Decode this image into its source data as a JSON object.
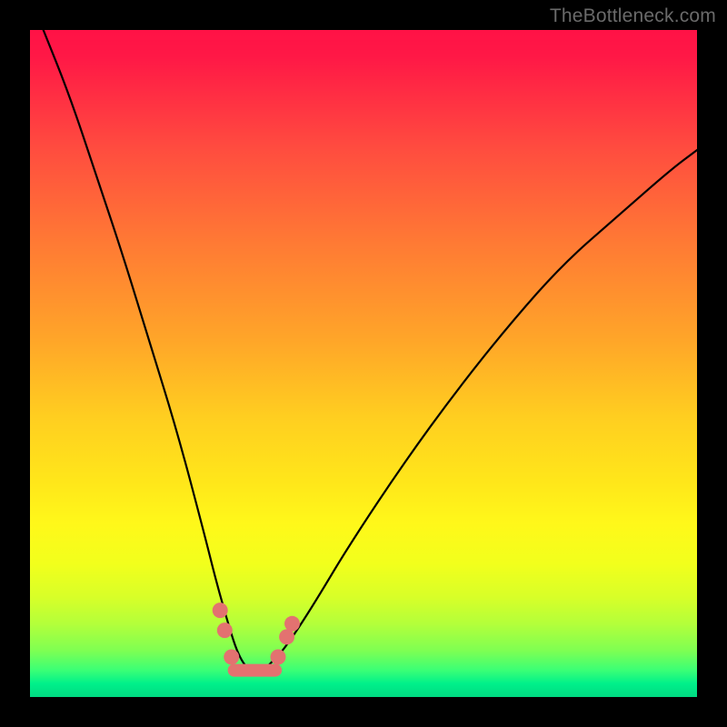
{
  "watermark": "TheBottleneck.com",
  "chart_data": {
    "type": "line",
    "title": "",
    "xlabel": "",
    "ylabel": "",
    "xlim": [
      0,
      100
    ],
    "ylim": [
      0,
      100
    ],
    "gradient_meaning": "background color encodes bottleneck severity: red=high (bad), green=low (optimal)",
    "series": [
      {
        "name": "bottleneck-curve",
        "x": [
          2,
          6,
          10,
          14,
          18,
          22,
          26,
          28,
          30,
          31,
          32,
          33,
          34,
          35,
          36,
          38,
          42,
          48,
          56,
          64,
          72,
          80,
          88,
          96,
          100
        ],
        "values": [
          100,
          90,
          78,
          66,
          53,
          40,
          25,
          17,
          10,
          7,
          5,
          4,
          4,
          4,
          5,
          7,
          13,
          23,
          35,
          46,
          56,
          65,
          72,
          79,
          82
        ]
      }
    ],
    "markers": {
      "name": "curve-dots",
      "color": "#e37270",
      "points": [
        {
          "x": 28.5,
          "y": 13
        },
        {
          "x": 29.2,
          "y": 10
        },
        {
          "x": 30.2,
          "y": 6
        },
        {
          "x": 37.2,
          "y": 6
        },
        {
          "x": 38.5,
          "y": 9
        },
        {
          "x": 39.3,
          "y": 11
        }
      ]
    },
    "flat_segment": {
      "name": "valley-floor",
      "color": "#e37270",
      "y": 4,
      "x_start": 30.6,
      "x_end": 36.8
    }
  }
}
